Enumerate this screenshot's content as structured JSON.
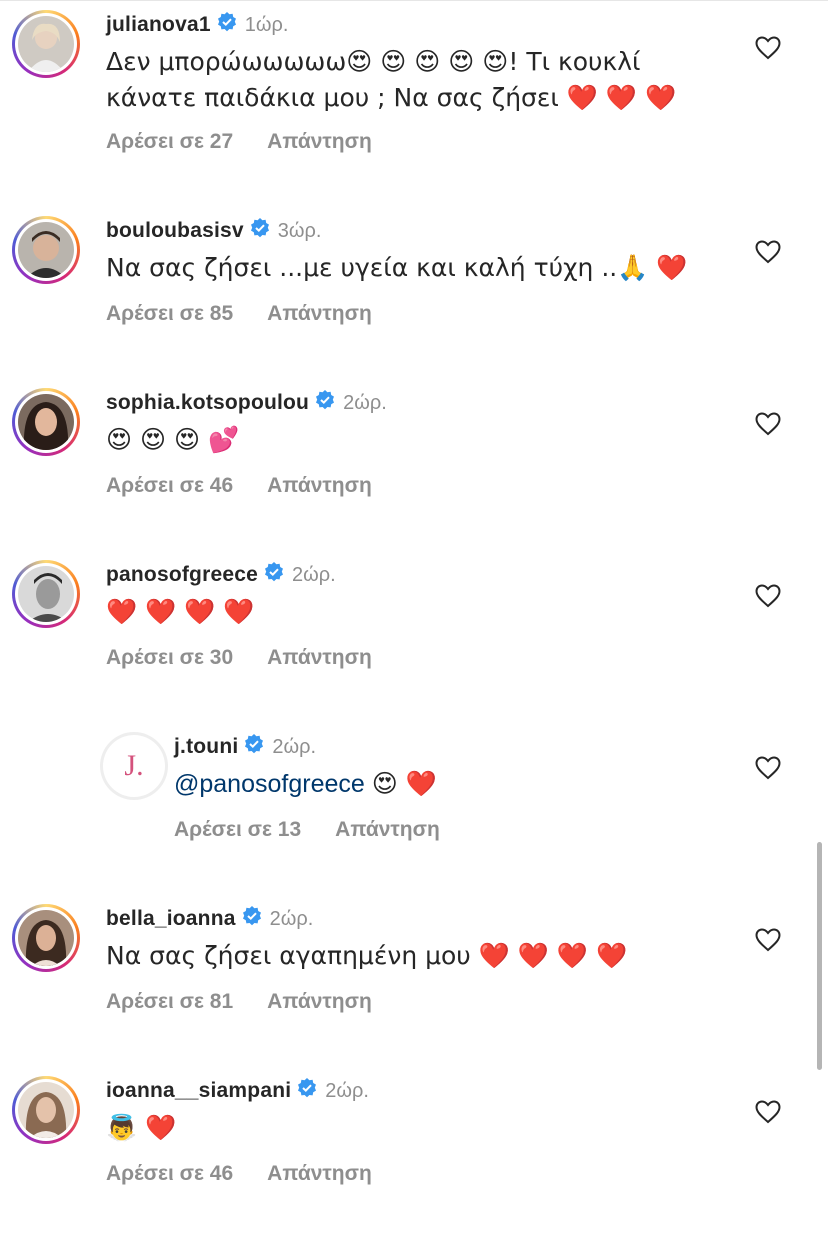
{
  "comments": [
    {
      "username": "julianova1",
      "time": "1ώρ.",
      "text_line1": "Δεν μπορώωωωωω😍 😍 😍 😍 😍! Τι κουκλί",
      "text_line2": "κάνατε παιδάκια μου ; Να σας ζήσει ❤️ ❤️ ❤️",
      "likes": "Αρέσει σε 27",
      "reply": "Απάντηση"
    },
    {
      "username": "bouloubasisv",
      "time": "3ώρ.",
      "text_line1": "Να σας ζήσει ...με υγεία και καλή τύχη ..🙏 ❤️",
      "likes": "Αρέσει σε 85",
      "reply": "Απάντηση"
    },
    {
      "username": "sophia.kotsopoulou",
      "time": "2ώρ.",
      "text_line1": "😍 😍 😍 💕",
      "likes": "Αρέσει σε 46",
      "reply": "Απάντηση"
    },
    {
      "username": "panosofgreece",
      "time": "2ώρ.",
      "text_line1": "❤️ ❤️ ❤️ ❤️",
      "likes": "Αρέσει σε 30",
      "reply": "Απάντηση"
    },
    {
      "username": "j.touni",
      "time": "2ώρ.",
      "mention": "@panosofgreece",
      "text_after_mention": "😍 ❤️",
      "avatar_letter": "J.",
      "likes": "Αρέσει σε 13",
      "reply": "Απάντηση"
    },
    {
      "username": "bella_ioanna",
      "time": "2ώρ.",
      "text_line1": "Να σας ζήσει αγαπημένη μου ❤️ ❤️ ❤️ ❤️",
      "likes": "Αρέσει σε 81",
      "reply": "Απάντηση"
    },
    {
      "username": "ioanna__siampani",
      "time": "2ώρ.",
      "text_line1": "👼 ❤️",
      "likes": "Αρέσει σε 46",
      "reply": "Απάντηση"
    }
  ],
  "icons": {
    "verified": "verified-badge-icon",
    "like": "heart-outline-icon"
  },
  "colors": {
    "verified_blue": "#3897f0",
    "meta_gray": "#8e8e8e",
    "mention_blue": "#00376b"
  }
}
